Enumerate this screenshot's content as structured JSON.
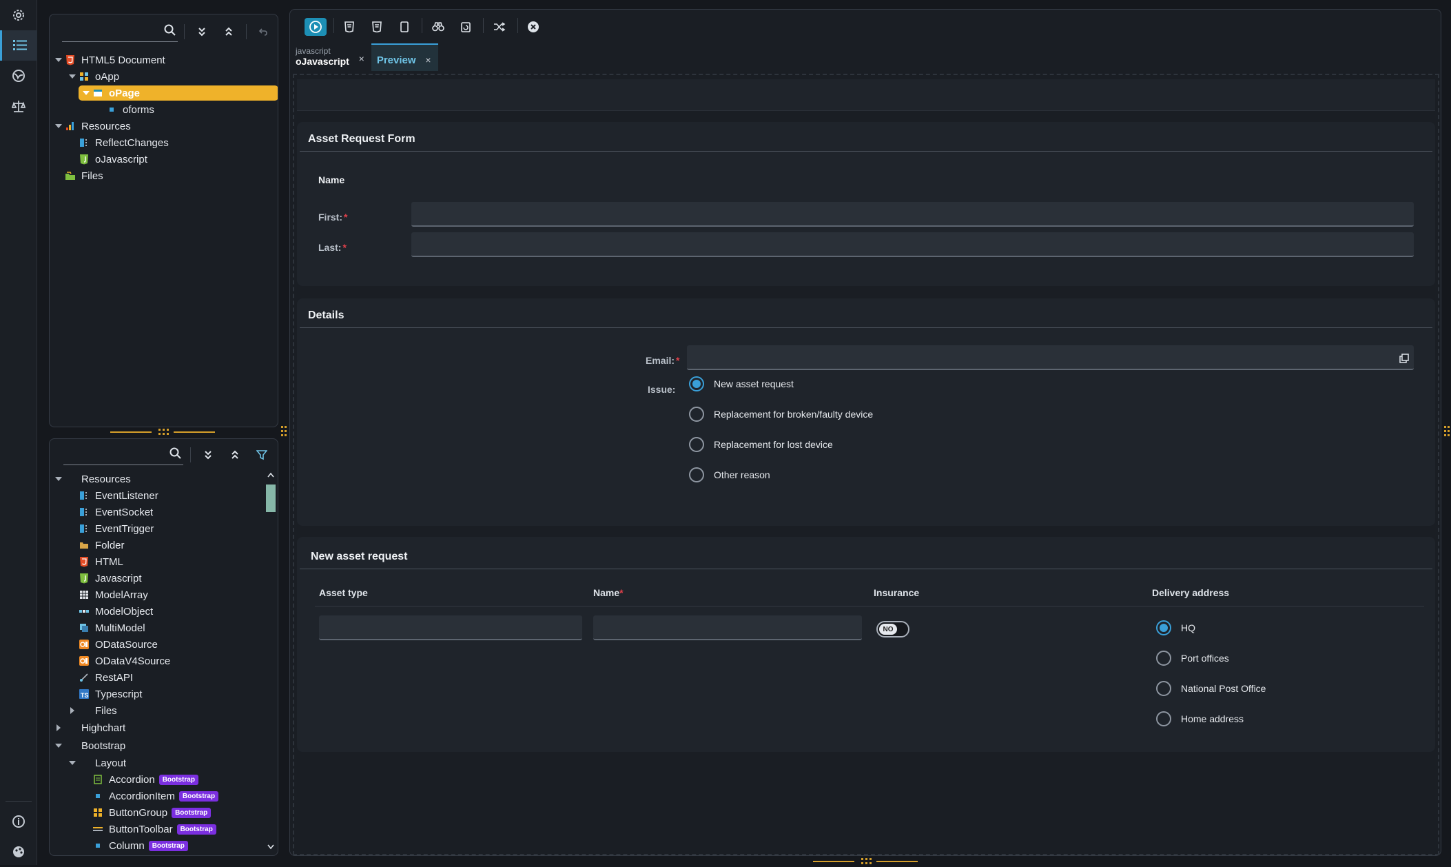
{
  "rail": {
    "icons": [
      "gear-icon",
      "list-icon",
      "globe-icon",
      "balance-icon",
      "info-icon",
      "palette-icon"
    ]
  },
  "outline": {
    "search_placeholder": "",
    "tree": [
      {
        "label": "HTML5 Document",
        "icon": "html5-icon"
      },
      {
        "label": "oApp",
        "icon": "app-icon"
      },
      {
        "label": "oPage",
        "icon": "page-icon"
      },
      {
        "label": "oforms",
        "icon": "dot-icon"
      },
      {
        "label": "Resources",
        "icon": "resources-icon"
      },
      {
        "label": "ReflectChanges",
        "icon": "event-icon"
      },
      {
        "label": "oJavascript",
        "icon": "js-icon"
      },
      {
        "label": "Files",
        "icon": "files-icon"
      }
    ]
  },
  "library": {
    "search_placeholder": "",
    "tree": [
      {
        "label": "Resources"
      },
      {
        "label": "EventListener"
      },
      {
        "label": "EventSocket"
      },
      {
        "label": "EventTrigger"
      },
      {
        "label": "Folder"
      },
      {
        "label": "HTML"
      },
      {
        "label": "Javascript"
      },
      {
        "label": "ModelArray"
      },
      {
        "label": "ModelObject"
      },
      {
        "label": "MultiModel"
      },
      {
        "label": "ODataSource"
      },
      {
        "label": "ODataV4Source"
      },
      {
        "label": "RestAPI"
      },
      {
        "label": "Typescript"
      },
      {
        "label": "Files"
      },
      {
        "label": "Highchart"
      },
      {
        "label": "Bootstrap"
      },
      {
        "label": "Layout"
      },
      {
        "label": "Accordion",
        "badge": "Bootstrap"
      },
      {
        "label": "AccordionItem",
        "badge": "Bootstrap"
      },
      {
        "label": "ButtonGroup",
        "badge": "Bootstrap"
      },
      {
        "label": "ButtonToolbar",
        "badge": "Bootstrap"
      },
      {
        "label": "Column",
        "badge": "Bootstrap"
      }
    ]
  },
  "tabs": [
    {
      "small": "javascript",
      "label": "oJavascript",
      "close": "×"
    },
    {
      "label": "Preview",
      "close": "×"
    }
  ],
  "form": {
    "title": "Asset Request Form",
    "name_section": {
      "heading": "Name",
      "first_label": "First:",
      "last_label": "Last:",
      "required": "*",
      "first_value": "",
      "last_value": ""
    },
    "details": {
      "title": "Details",
      "email_label": "Email:",
      "email_value": "",
      "issue_label": "Issue:",
      "options": [
        "New asset request",
        "Replacement for broken/faulty device",
        "Replacement for lost device",
        "Other reason"
      ],
      "selected": "New asset request"
    },
    "request": {
      "title": "New asset request",
      "columns": [
        "Asset type",
        "Name",
        "Insurance",
        "Delivery address"
      ],
      "asset_type_value": "",
      "name_value": "",
      "insurance": "NO",
      "delivery_options": [
        "HQ",
        "Port offices",
        "National Post Office",
        "Home address"
      ],
      "delivery_selected": "HQ"
    }
  },
  "colors": {
    "accent": "#3aa0d9",
    "selection": "#efb22a",
    "badge": "#7b2fe0",
    "required": "#e0404a"
  }
}
